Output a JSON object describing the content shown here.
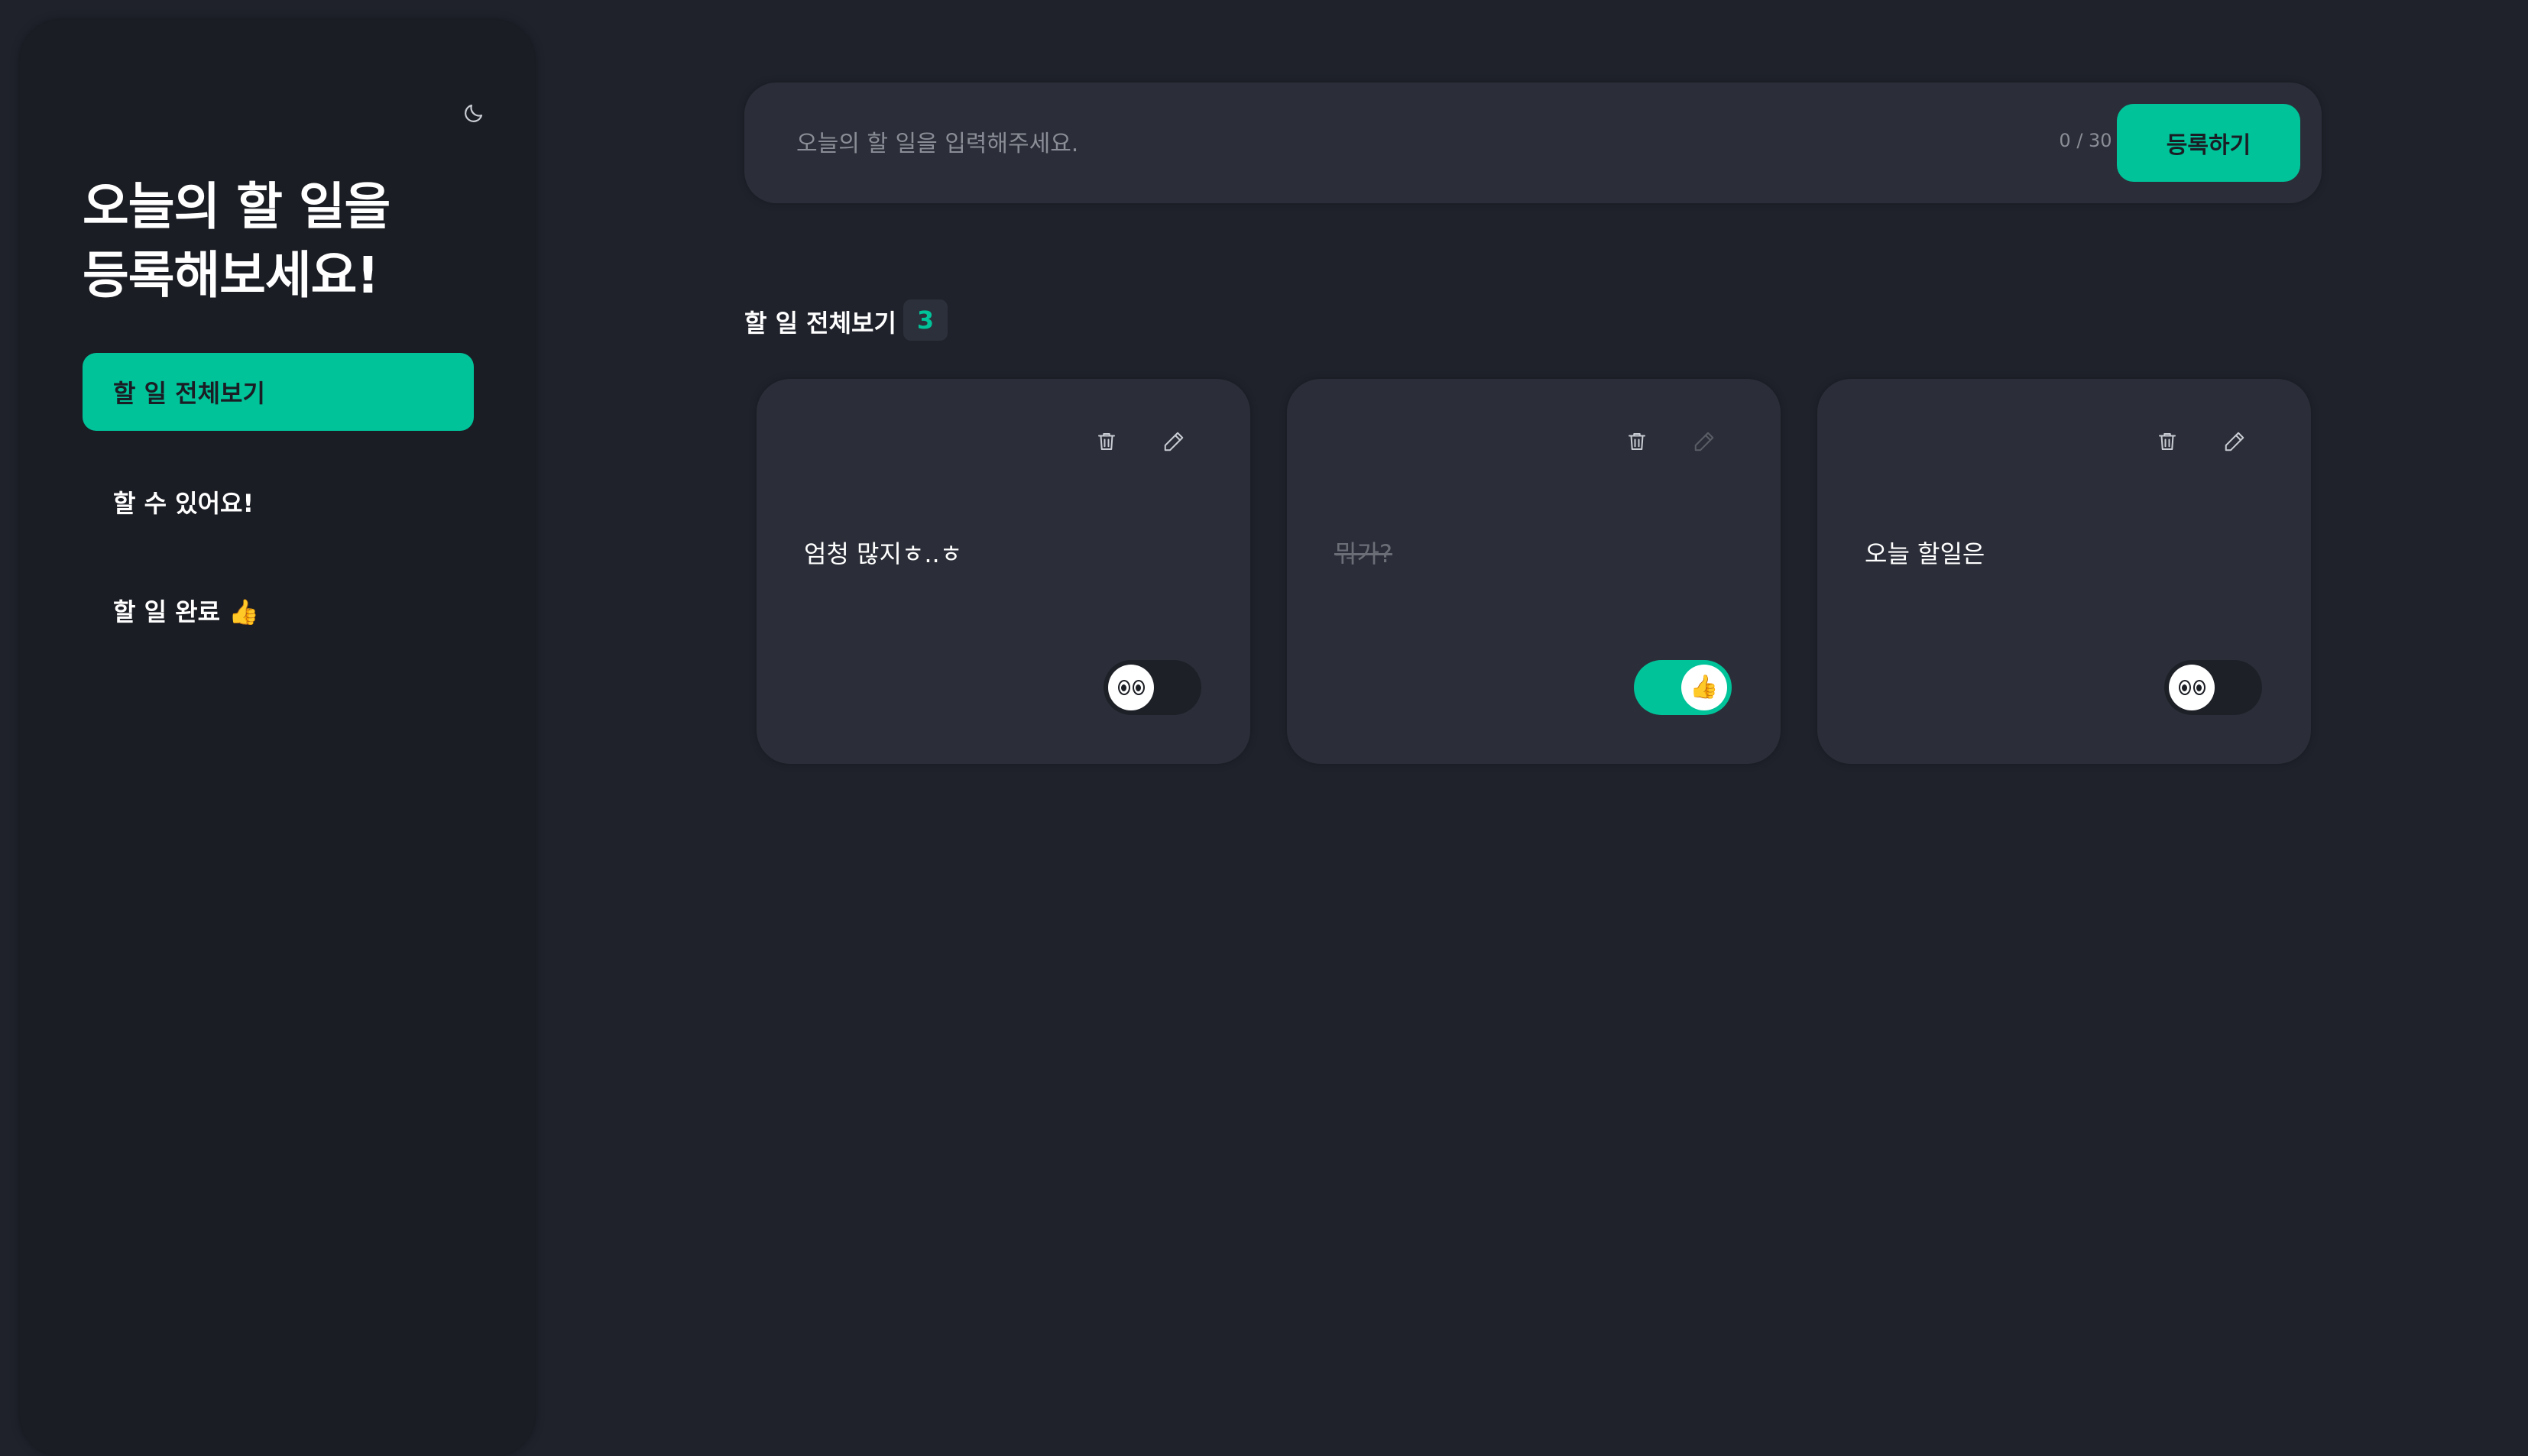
{
  "sidebar": {
    "title_line1": "오늘의 할 일을",
    "title_line2": "등록해보세요!",
    "theme_icon": "moon-icon",
    "items": [
      {
        "label": "할 일 전체보기",
        "active": true
      },
      {
        "label": "할 수 있어요!",
        "active": false
      },
      {
        "label": "할 일 완료 👍",
        "active": false
      }
    ]
  },
  "input": {
    "placeholder": "오늘의 할 일을 입력해주세요.",
    "value": "",
    "char_count": "0 / 30",
    "submit_label": "등록하기"
  },
  "list": {
    "title": "할 일 전체보기",
    "count": "3",
    "items": [
      {
        "text": "엄청 많지ㅎ..ㅎ",
        "done": false,
        "toggle_icon": "eyes-icon"
      },
      {
        "text": "뭐가?",
        "done": true,
        "toggle_icon": "thumbs-up-icon",
        "toggle_emoji": "👍"
      },
      {
        "text": "오늘 할일은",
        "done": false,
        "toggle_icon": "eyes-icon"
      }
    ]
  },
  "colors": {
    "accent": "#00c39a",
    "background": "#1f222b",
    "sidebar": "#1b1d24",
    "card": "#2b2e38"
  }
}
